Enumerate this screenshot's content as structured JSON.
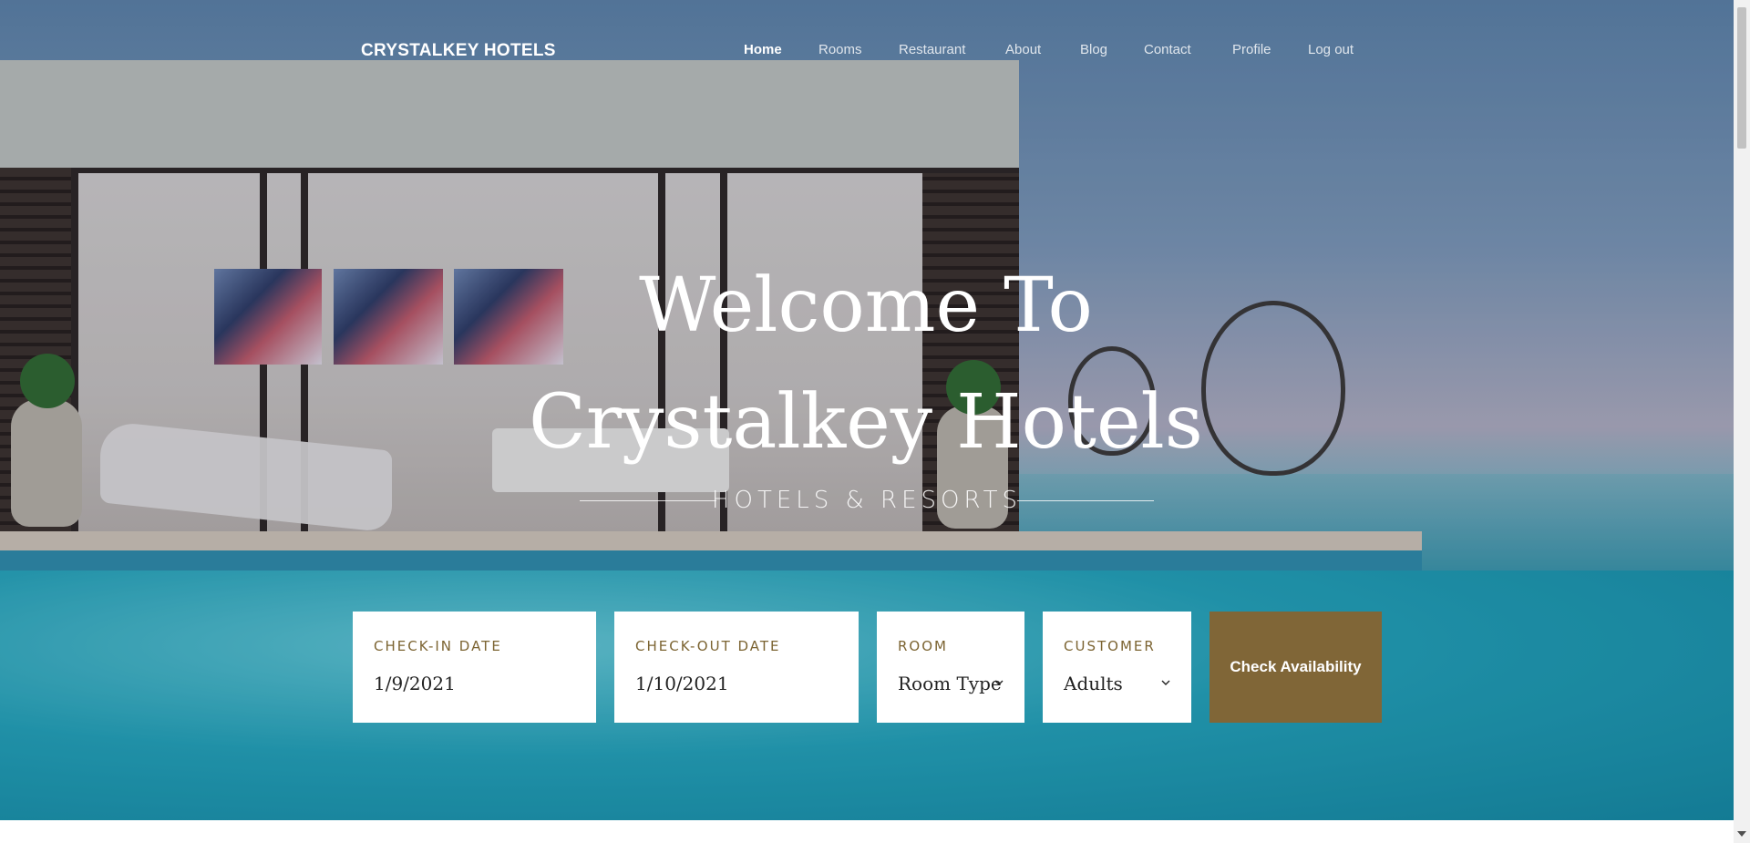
{
  "brand": {
    "name": "CRYSTALKEY HOTELS"
  },
  "nav": {
    "items": [
      {
        "label": "Home",
        "active": true
      },
      {
        "label": "Rooms"
      },
      {
        "label": "Restaurant"
      },
      {
        "label": "About"
      },
      {
        "label": "Blog"
      },
      {
        "label": "Contact"
      },
      {
        "label": "Profile"
      },
      {
        "label": "Log out"
      }
    ]
  },
  "hero": {
    "headline": "Welcome To Crystalkey Hotels",
    "tagline": "HOTELS & RESORTS"
  },
  "booking": {
    "checkin": {
      "label": "CHECK-IN DATE",
      "value": "1/9/2021"
    },
    "checkout": {
      "label": "CHECK-OUT DATE",
      "value": "1/10/2021"
    },
    "room": {
      "label": "ROOM",
      "selected": "Room Type"
    },
    "customer": {
      "label": "CUSTOMER",
      "selected": "Adults"
    },
    "submit_label": "Check Availability"
  },
  "colors": {
    "accent": "#806637",
    "label": "#7c6432"
  }
}
